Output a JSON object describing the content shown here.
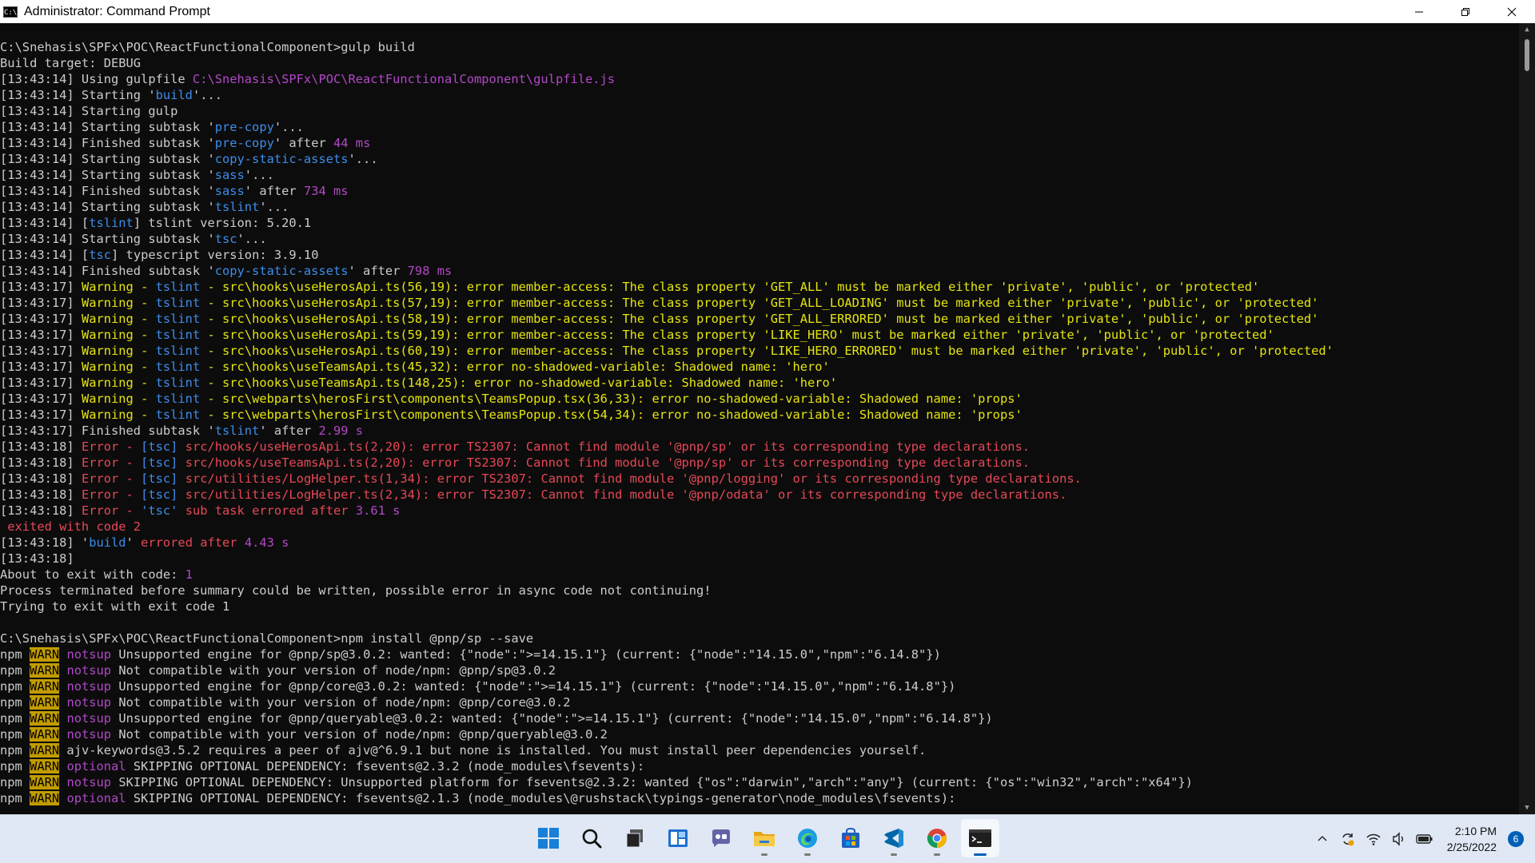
{
  "window": {
    "title": "Administrator: Command Prompt",
    "icon_text": "C:\\"
  },
  "colors": {
    "default": "#cccccc",
    "cyan": "#3b8eea",
    "magenta": "#b148c6",
    "yellow": "#e5e510",
    "red": "#e74856",
    "warn_bg": "#c19c00",
    "warn_fg": "#000000",
    "bg": "#0c0c0c"
  },
  "lines": [
    [
      [
        "default",
        "C:\\Snehasis\\SPFx\\POC\\ReactFunctionalComponent>gulp build"
      ]
    ],
    [
      [
        "default",
        "Build target: DEBUG"
      ]
    ],
    [
      [
        "default",
        "[13:43:14] Using gulpfile "
      ],
      [
        "magenta",
        "C:\\Snehasis\\SPFx\\POC\\ReactFunctionalComponent\\gulpfile.js"
      ]
    ],
    [
      [
        "default",
        "[13:43:14] Starting '"
      ],
      [
        "cyan",
        "build"
      ],
      [
        "default",
        "'..."
      ]
    ],
    [
      [
        "default",
        "[13:43:14] Starting gulp"
      ]
    ],
    [
      [
        "default",
        "[13:43:14] Starting subtask '"
      ],
      [
        "cyan",
        "pre-copy"
      ],
      [
        "default",
        "'..."
      ]
    ],
    [
      [
        "default",
        "[13:43:14] Finished subtask '"
      ],
      [
        "cyan",
        "pre-copy"
      ],
      [
        "default",
        "' after "
      ],
      [
        "magenta",
        "44 ms"
      ]
    ],
    [
      [
        "default",
        "[13:43:14] Starting subtask '"
      ],
      [
        "cyan",
        "copy-static-assets"
      ],
      [
        "default",
        "'..."
      ]
    ],
    [
      [
        "default",
        "[13:43:14] Starting subtask '"
      ],
      [
        "cyan",
        "sass"
      ],
      [
        "default",
        "'..."
      ]
    ],
    [
      [
        "default",
        "[13:43:14] Finished subtask '"
      ],
      [
        "cyan",
        "sass"
      ],
      [
        "default",
        "' after "
      ],
      [
        "magenta",
        "734 ms"
      ]
    ],
    [
      [
        "default",
        "[13:43:14] Starting subtask '"
      ],
      [
        "cyan",
        "tslint"
      ],
      [
        "default",
        "'..."
      ]
    ],
    [
      [
        "default",
        "[13:43:14] ["
      ],
      [
        "cyan",
        "tslint"
      ],
      [
        "default",
        "] tslint version: 5.20.1"
      ]
    ],
    [
      [
        "default",
        "[13:43:14] Starting subtask '"
      ],
      [
        "cyan",
        "tsc"
      ],
      [
        "default",
        "'..."
      ]
    ],
    [
      [
        "default",
        "[13:43:14] ["
      ],
      [
        "cyan",
        "tsc"
      ],
      [
        "default",
        "] typescript version: 3.9.10"
      ]
    ],
    [
      [
        "default",
        "[13:43:14] Finished subtask '"
      ],
      [
        "cyan",
        "copy-static-assets"
      ],
      [
        "default",
        "' after "
      ],
      [
        "magenta",
        "798 ms"
      ]
    ],
    [
      [
        "default",
        "[13:43:17] "
      ],
      [
        "yellow",
        "Warning - "
      ],
      [
        "cyan",
        "tslint"
      ],
      [
        "yellow",
        " - src\\hooks\\useHerosApi.ts(56,19): error member-access: The class property 'GET_ALL' must be marked either 'private', 'public', or 'protected'"
      ]
    ],
    [
      [
        "default",
        "[13:43:17] "
      ],
      [
        "yellow",
        "Warning - "
      ],
      [
        "cyan",
        "tslint"
      ],
      [
        "yellow",
        " - src\\hooks\\useHerosApi.ts(57,19): error member-access: The class property 'GET_ALL_LOADING' must be marked either 'private', 'public', or 'protected'"
      ]
    ],
    [
      [
        "default",
        "[13:43:17] "
      ],
      [
        "yellow",
        "Warning - "
      ],
      [
        "cyan",
        "tslint"
      ],
      [
        "yellow",
        " - src\\hooks\\useHerosApi.ts(58,19): error member-access: The class property 'GET_ALL_ERRORED' must be marked either 'private', 'public', or 'protected'"
      ]
    ],
    [
      [
        "default",
        "[13:43:17] "
      ],
      [
        "yellow",
        "Warning - "
      ],
      [
        "cyan",
        "tslint"
      ],
      [
        "yellow",
        " - src\\hooks\\useHerosApi.ts(59,19): error member-access: The class property 'LIKE_HERO' must be marked either 'private', 'public', or 'protected'"
      ]
    ],
    [
      [
        "default",
        "[13:43:17] "
      ],
      [
        "yellow",
        "Warning - "
      ],
      [
        "cyan",
        "tslint"
      ],
      [
        "yellow",
        " - src\\hooks\\useHerosApi.ts(60,19): error member-access: The class property 'LIKE_HERO_ERRORED' must be marked either 'private', 'public', or 'protected'"
      ]
    ],
    [
      [
        "default",
        "[13:43:17] "
      ],
      [
        "yellow",
        "Warning - "
      ],
      [
        "cyan",
        "tslint"
      ],
      [
        "yellow",
        " - src\\hooks\\useTeamsApi.ts(45,32): error no-shadowed-variable: Shadowed name: 'hero'"
      ]
    ],
    [
      [
        "default",
        "[13:43:17] "
      ],
      [
        "yellow",
        "Warning - "
      ],
      [
        "cyan",
        "tslint"
      ],
      [
        "yellow",
        " - src\\hooks\\useTeamsApi.ts(148,25): error no-shadowed-variable: Shadowed name: 'hero'"
      ]
    ],
    [
      [
        "default",
        "[13:43:17] "
      ],
      [
        "yellow",
        "Warning - "
      ],
      [
        "cyan",
        "tslint"
      ],
      [
        "yellow",
        " - src\\webparts\\herosFirst\\components\\TeamsPopup.tsx(36,33): error no-shadowed-variable: Shadowed name: 'props'"
      ]
    ],
    [
      [
        "default",
        "[13:43:17] "
      ],
      [
        "yellow",
        "Warning - "
      ],
      [
        "cyan",
        "tslint"
      ],
      [
        "yellow",
        " - src\\webparts\\herosFirst\\components\\TeamsPopup.tsx(54,34): error no-shadowed-variable: Shadowed name: 'props'"
      ]
    ],
    [
      [
        "default",
        "[13:43:17] Finished subtask '"
      ],
      [
        "cyan",
        "tslint"
      ],
      [
        "default",
        "' after "
      ],
      [
        "magenta",
        "2.99 s"
      ]
    ],
    [
      [
        "default",
        "[13:43:18] "
      ],
      [
        "red",
        "Error - "
      ],
      [
        "cyan",
        "[tsc]"
      ],
      [
        "red",
        " src/hooks/useHerosApi.ts(2,20): error TS2307: Cannot find module '@pnp/sp' or its corresponding type declarations."
      ]
    ],
    [
      [
        "default",
        "[13:43:18] "
      ],
      [
        "red",
        "Error - "
      ],
      [
        "cyan",
        "[tsc]"
      ],
      [
        "red",
        " src/hooks/useTeamsApi.ts(2,20): error TS2307: Cannot find module '@pnp/sp' or its corresponding type declarations."
      ]
    ],
    [
      [
        "default",
        "[13:43:18] "
      ],
      [
        "red",
        "Error - "
      ],
      [
        "cyan",
        "[tsc]"
      ],
      [
        "red",
        " src/utilities/LogHelper.ts(1,34): error TS2307: Cannot find module '@pnp/logging' or its corresponding type declarations."
      ]
    ],
    [
      [
        "default",
        "[13:43:18] "
      ],
      [
        "red",
        "Error - "
      ],
      [
        "cyan",
        "[tsc]"
      ],
      [
        "red",
        " src/utilities/LogHelper.ts(2,34): error TS2307: Cannot find module '@pnp/odata' or its corresponding type declarations."
      ]
    ],
    [
      [
        "default",
        "[13:43:18] "
      ],
      [
        "red",
        "Error - "
      ],
      [
        "cyan",
        "'tsc'"
      ],
      [
        "red",
        " sub task errored after "
      ],
      [
        "magenta",
        "3.61 s"
      ]
    ],
    [
      [
        "red",
        " exited with code 2"
      ]
    ],
    [
      [
        "default",
        "[13:43:18] '"
      ],
      [
        "cyan",
        "build"
      ],
      [
        "default",
        "' "
      ],
      [
        "red",
        "errored after "
      ],
      [
        "magenta",
        "4.43 s"
      ]
    ],
    [
      [
        "default",
        "[13:43:18]"
      ]
    ],
    [
      [
        "default",
        "About to exit with code: "
      ],
      [
        "magenta",
        "1"
      ]
    ],
    [
      [
        "default",
        "Process terminated before summary could be written, possible error in async code not continuing!"
      ]
    ],
    [
      [
        "default",
        "Trying to exit with exit code 1"
      ]
    ],
    [
      [
        "default",
        ""
      ]
    ],
    [
      [
        "default",
        "C:\\Snehasis\\SPFx\\POC\\ReactFunctionalComponent>npm install @pnp/sp --save"
      ]
    ],
    [
      [
        "default",
        "npm "
      ],
      [
        "warn",
        "WARN"
      ],
      [
        "default",
        " "
      ],
      [
        "magenta",
        "notsup"
      ],
      [
        "default",
        " Unsupported engine for @pnp/sp@3.0.2: wanted: {\"node\":\">=14.15.1\"} (current: {\"node\":\"14.15.0\",\"npm\":\"6.14.8\"})"
      ]
    ],
    [
      [
        "default",
        "npm "
      ],
      [
        "warn",
        "WARN"
      ],
      [
        "default",
        " "
      ],
      [
        "magenta",
        "notsup"
      ],
      [
        "default",
        " Not compatible with your version of node/npm: @pnp/sp@3.0.2"
      ]
    ],
    [
      [
        "default",
        "npm "
      ],
      [
        "warn",
        "WARN"
      ],
      [
        "default",
        " "
      ],
      [
        "magenta",
        "notsup"
      ],
      [
        "default",
        " Unsupported engine for @pnp/core@3.0.2: wanted: {\"node\":\">=14.15.1\"} (current: {\"node\":\"14.15.0\",\"npm\":\"6.14.8\"})"
      ]
    ],
    [
      [
        "default",
        "npm "
      ],
      [
        "warn",
        "WARN"
      ],
      [
        "default",
        " "
      ],
      [
        "magenta",
        "notsup"
      ],
      [
        "default",
        " Not compatible with your version of node/npm: @pnp/core@3.0.2"
      ]
    ],
    [
      [
        "default",
        "npm "
      ],
      [
        "warn",
        "WARN"
      ],
      [
        "default",
        " "
      ],
      [
        "magenta",
        "notsup"
      ],
      [
        "default",
        " Unsupported engine for @pnp/queryable@3.0.2: wanted: {\"node\":\">=14.15.1\"} (current: {\"node\":\"14.15.0\",\"npm\":\"6.14.8\"})"
      ]
    ],
    [
      [
        "default",
        "npm "
      ],
      [
        "warn",
        "WARN"
      ],
      [
        "default",
        " "
      ],
      [
        "magenta",
        "notsup"
      ],
      [
        "default",
        " Not compatible with your version of node/npm: @pnp/queryable@3.0.2"
      ]
    ],
    [
      [
        "default",
        "npm "
      ],
      [
        "warn",
        "WARN"
      ],
      [
        "default",
        " ajv-keywords@3.5.2 requires a peer of ajv@^6.9.1 but none is installed. You must install peer dependencies yourself."
      ]
    ],
    [
      [
        "default",
        "npm "
      ],
      [
        "warn",
        "WARN"
      ],
      [
        "default",
        " "
      ],
      [
        "magenta",
        "optional"
      ],
      [
        "default",
        " SKIPPING OPTIONAL DEPENDENCY: fsevents@2.3.2 (node_modules\\fsevents):"
      ]
    ],
    [
      [
        "default",
        "npm "
      ],
      [
        "warn",
        "WARN"
      ],
      [
        "default",
        " "
      ],
      [
        "magenta",
        "notsup"
      ],
      [
        "default",
        " SKIPPING OPTIONAL DEPENDENCY: Unsupported platform for fsevents@2.3.2: wanted {\"os\":\"darwin\",\"arch\":\"any\"} (current: {\"os\":\"win32\",\"arch\":\"x64\"})"
      ]
    ],
    [
      [
        "default",
        "npm "
      ],
      [
        "warn",
        "WARN"
      ],
      [
        "default",
        " "
      ],
      [
        "magenta",
        "optional"
      ],
      [
        "default",
        " SKIPPING OPTIONAL DEPENDENCY: fsevents@2.1.3 (node_modules\\@rushstack\\typings-generator\\node_modules\\fsevents):"
      ]
    ]
  ],
  "taskbar": {
    "apps": [
      {
        "name": "start",
        "icon": "windows-logo-icon",
        "running": false,
        "active": false
      },
      {
        "name": "search",
        "icon": "search-icon",
        "running": false,
        "active": false
      },
      {
        "name": "task-view",
        "icon": "task-view-icon",
        "running": false,
        "active": false
      },
      {
        "name": "widgets",
        "icon": "widgets-icon",
        "running": false,
        "active": false
      },
      {
        "name": "chat",
        "icon": "chat-icon",
        "running": false,
        "active": false
      },
      {
        "name": "file-explorer",
        "icon": "folder-icon",
        "running": true,
        "active": false
      },
      {
        "name": "edge",
        "icon": "edge-icon",
        "running": true,
        "active": false
      },
      {
        "name": "store",
        "icon": "store-icon",
        "running": false,
        "active": false
      },
      {
        "name": "vscode",
        "icon": "vscode-icon",
        "running": true,
        "active": false
      },
      {
        "name": "chrome",
        "icon": "chrome-icon",
        "running": true,
        "active": false
      },
      {
        "name": "terminal",
        "icon": "terminal-icon",
        "running": true,
        "active": true
      }
    ],
    "tray": {
      "time": "2:10 PM",
      "date": "2/25/2022",
      "notification_count": "6"
    }
  }
}
